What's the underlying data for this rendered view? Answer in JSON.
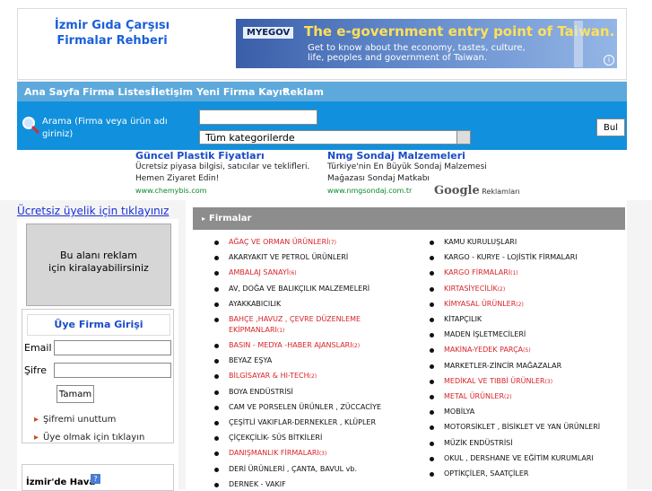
{
  "site": {
    "title_line1": "İzmir Gıda Çarşısı",
    "title_line2": "Firmalar Rehberi"
  },
  "banner": {
    "logo": "MYEGOV",
    "headline": "The e-government entry point of Taiwan.",
    "subtext": "Get to know about the economy, tastes, culture, life, peoples and government of Taiwan."
  },
  "nav": {
    "items": [
      "Ana Sayfa",
      "Firma Listesi",
      "İletişim",
      "Yeni Firma Kayıt",
      "Reklam"
    ]
  },
  "search": {
    "label": "Arama (Firma veya ürün adı giriniz)",
    "query": "",
    "category": "Tüm kategorilerde",
    "button": "Bul"
  },
  "ads": [
    {
      "title": "Güncel Plastik Fiyatları",
      "text": "Ücretsiz piyasa bilgisi, satıcılar ve teklifleri. Hemen Ziyaret Edin!",
      "url": "www.chemybis.com"
    },
    {
      "title": "Nmg Sondaj Malzemeleri",
      "text": "Türkiye'nin En Büyük Sondaj Malzemesi Mağazası Sondaj Matkabı",
      "url": "www.nmgsondaj.com.tr"
    }
  ],
  "google_ads": {
    "brand": "Google",
    "label": "Reklamları"
  },
  "signup_link": "Ücretsiz üyelik için tıklayınız",
  "ad_space": {
    "line1": "Bu alanı reklam",
    "line2": "için kiralayabilirsiniz"
  },
  "login": {
    "title": "Üye Firma Girişi",
    "email_label": "Email",
    "password_label": "Şifre",
    "submit": "Tamam",
    "forgot": "Şifremi unuttum",
    "register": "Üye olmak için tıklayın"
  },
  "weather": {
    "title": "İzmir'de Hava",
    "icon": "?"
  },
  "firms": {
    "header": "Firmalar",
    "left": [
      {
        "label": "AĞAÇ VE ORMAN ÜRÜNLERİ",
        "count": "(7)",
        "red": true
      },
      {
        "label": "AKARYAKIT VE PETROL ÜRÜNLERİ",
        "count": "",
        "red": false
      },
      {
        "label": "AMBALAJ SANAYİ",
        "count": "(6)",
        "red": true
      },
      {
        "label": "AV, DOĞA VE BALIKÇILIK MALZEMELERİ",
        "count": "",
        "red": false
      },
      {
        "label": "AYAKKABICILIK",
        "count": "",
        "red": false
      },
      {
        "label": "BAHÇE ,HAVUZ , ÇEVRE DÜZENLEME EKİPMANLARI",
        "count": "(1)",
        "red": true
      },
      {
        "label": "BASIN - MEDYA -HABER AJANSLARI",
        "count": "(2)",
        "red": true
      },
      {
        "label": "BEYAZ EŞYA",
        "count": "",
        "red": false
      },
      {
        "label": "BİLGİSAYAR & HI-TECH",
        "count": "(2)",
        "red": true
      },
      {
        "label": "BOYA ENDÜSTRİSİ",
        "count": "",
        "red": false
      },
      {
        "label": "CAM VE PORSELEN ÜRÜNLER , ZÜCCACİYE",
        "count": "",
        "red": false
      },
      {
        "label": "ÇEŞİTLİ VAKIFLAR-DERNEKLER , KLÜPLER",
        "count": "",
        "red": false
      },
      {
        "label": "ÇİÇEKÇİLİK- SÜS BİTKİLERİ",
        "count": "",
        "red": false
      },
      {
        "label": "DANIŞMANLIK FİRMALARI",
        "count": "(3)",
        "red": true
      },
      {
        "label": "DERİ ÜRÜNLERİ , ÇANTA, BAVUL vb.",
        "count": "",
        "red": false
      },
      {
        "label": "DERNEK - VAKIF",
        "count": "",
        "red": false
      }
    ],
    "right": [
      {
        "label": "KAMU KURULUŞLARI",
        "count": "",
        "red": false
      },
      {
        "label": "KARGO - KURYE - LOJİSTİK FİRMALARI",
        "count": "",
        "red": false
      },
      {
        "label": "KARGO FİRMALARI",
        "count": "(1)",
        "red": true
      },
      {
        "label": "KIRTASİYECİLİK",
        "count": "(2)",
        "red": true
      },
      {
        "label": "KİMYASAL ÜRÜNLER",
        "count": "(2)",
        "red": true
      },
      {
        "label": "KİTAPÇILIK",
        "count": "",
        "red": false
      },
      {
        "label": "MADEN İŞLETMECİLERİ",
        "count": "",
        "red": false
      },
      {
        "label": "MAKİNA-YEDEK PARÇA",
        "count": "(5)",
        "red": true
      },
      {
        "label": "MARKETLER-ZİNCİR MAĞAZALAR",
        "count": "",
        "red": false
      },
      {
        "label": "MEDİKAL VE TIBBİ ÜRÜNLER",
        "count": "(3)",
        "red": true
      },
      {
        "label": "METAL ÜRÜNLER",
        "count": "(2)",
        "red": true
      },
      {
        "label": "MOBİLYA",
        "count": "",
        "red": false
      },
      {
        "label": "MOTORSİKLET , BİSİKLET VE YAN ÜRÜNLERİ",
        "count": "",
        "red": false
      },
      {
        "label": "MÜZİK ENDÜSTRİSİ",
        "count": "",
        "red": false
      },
      {
        "label": "OKUL , DERSHANE VE EĞİTİM KURUMLARI",
        "count": "",
        "red": false
      },
      {
        "label": "OPTİKÇİLER, SAATÇİLER",
        "count": "",
        "red": false
      }
    ]
  }
}
